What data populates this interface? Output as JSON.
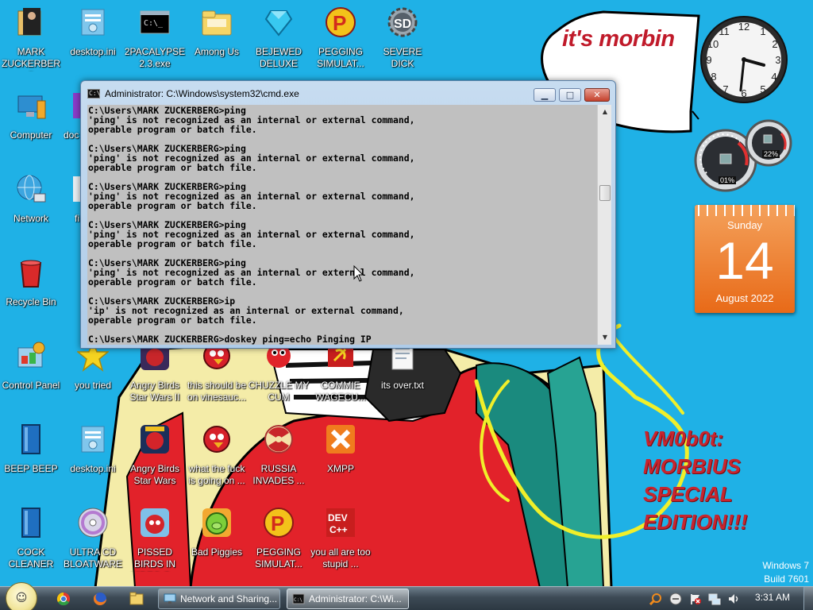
{
  "desktop": {
    "background_color": "#1fb1e6",
    "icons": [
      {
        "label": "MARK ZUCKERBERG",
        "icon": "folder-icon"
      },
      {
        "label": "desktop.ini",
        "icon": "settings-file-icon"
      },
      {
        "label": "2PACALYPSE 2.3.exe",
        "icon": "cmd-exe-icon"
      },
      {
        "label": "Among Us",
        "icon": "folder-icon"
      },
      {
        "label": "BEJEWED DELUXE",
        "icon": "gem-icon"
      },
      {
        "label": "PEGGING SIMULAT...",
        "icon": "p-logo-icon"
      },
      {
        "label": "SEVERE DICK",
        "icon": "sd-gear-icon"
      },
      {
        "label": "Computer",
        "icon": "computer-icon"
      },
      {
        "label": "doc",
        "icon": "document-icon"
      },
      {
        "label": "Network",
        "icon": "network-globe-icon"
      },
      {
        "label": "fi",
        "icon": "file-icon"
      },
      {
        "label": "Recycle Bin",
        "icon": "recycle-bin-icon"
      },
      {
        "label": "Control Panel",
        "icon": "control-panel-icon"
      },
      {
        "label": "you tried",
        "icon": "gold-star-icon"
      },
      {
        "label": "Angry Birds Star Wars II",
        "icon": "angry-birds-sw2-icon"
      },
      {
        "label": "this should be on vinesauc...",
        "icon": "red-bird-icon"
      },
      {
        "label": "CHUZZLE MY CUM",
        "icon": "chuzzle-icon"
      },
      {
        "label": "COMMIE WAGECU...",
        "icon": "commie-icon"
      },
      {
        "label": "its over.txt",
        "icon": "text-file-icon"
      },
      {
        "label": "BEEP BEEP",
        "icon": "blue-book-icon"
      },
      {
        "label": "desktop.ini",
        "icon": "settings-file-icon"
      },
      {
        "label": "Angry Birds Star Wars",
        "icon": "angry-birds-sw-icon"
      },
      {
        "label": "what the fuck is going on ...",
        "icon": "red-bird-icon"
      },
      {
        "label": "RUSSIA INVADES ...",
        "icon": "radiation-icon"
      },
      {
        "label": "XMPP",
        "icon": "xampp-icon"
      },
      {
        "label": "COCK CLEANER",
        "icon": "blue-book-icon"
      },
      {
        "label": "ULTRA CD BLOATWARE",
        "icon": "cd-disc-icon"
      },
      {
        "label": "PISSED BIRDS IN VIDEO G...",
        "icon": "angry-birds-icon"
      },
      {
        "label": "Bad Piggies",
        "icon": "green-pig-icon"
      },
      {
        "label": "PEGGING SIMULAT...",
        "icon": "p-logo-icon"
      },
      {
        "label": "you all are too stupid ...",
        "icon": "dev-cpp-icon"
      }
    ]
  },
  "wallpaper": {
    "speech_bubble": "it's morbin",
    "edition_text": "VM0b0t:\nMORBIUS\nSPECIAL\nEDITION!!!",
    "watermark_line1": "Windows 7",
    "watermark_line2": "Build 7601"
  },
  "cmd_window": {
    "title": "Administrator: C:\\Windows\\system32\\cmd.exe",
    "lines": [
      "C:\\Users\\MARK ZUCKERBERG>ping",
      "'ping' is not recognized as an internal or external command,",
      "operable program or batch file.",
      "",
      "C:\\Users\\MARK ZUCKERBERG>ping",
      "'ping' is not recognized as an internal or external command,",
      "operable program or batch file.",
      "",
      "C:\\Users\\MARK ZUCKERBERG>ping",
      "'ping' is not recognized as an internal or external command,",
      "operable program or batch file.",
      "",
      "C:\\Users\\MARK ZUCKERBERG>ping",
      "'ping' is not recognized as an internal or external command,",
      "operable program or batch file.",
      "",
      "C:\\Users\\MARK ZUCKERBERG>ping",
      "'ping' is not recognized as an internal or external command,",
      "operable program or batch file.",
      "",
      "C:\\Users\\MARK ZUCKERBERG>ip",
      "'ip' is not recognized as an internal or external command,",
      "operable program or batch file.",
      "",
      "C:\\Users\\MARK ZUCKERBERG>doskey ping=echo Pinging IP"
    ],
    "buttons": {
      "minimize": "▁",
      "maximize": "□",
      "close": "✕"
    }
  },
  "gadgets": {
    "clock": {
      "hour": 3,
      "minute": 31
    },
    "cpu_meter": {
      "cpu": "01%",
      "memory": "22%"
    },
    "calendar": {
      "weekday": "Sunday",
      "day": "14",
      "month_year": "August 2022"
    }
  },
  "taskbar": {
    "start_icon": "windows-orb-icon",
    "pinned": [
      {
        "name": "chrome",
        "icon": "chrome-icon"
      },
      {
        "name": "firefox",
        "icon": "firefox-icon"
      },
      {
        "name": "explorer",
        "icon": "folder-icon"
      }
    ],
    "tasks": [
      {
        "label": "Network and Sharing...",
        "icon": "network-icon",
        "active": false
      },
      {
        "label": "Administrator: C:\\Wi...",
        "icon": "cmd-icon",
        "active": true
      }
    ],
    "tray": [
      "magnifier-icon",
      "volume-mixer-icon",
      "action-center-flag-icon",
      "network-icon",
      "speaker-icon"
    ],
    "time": "3:31 AM"
  }
}
